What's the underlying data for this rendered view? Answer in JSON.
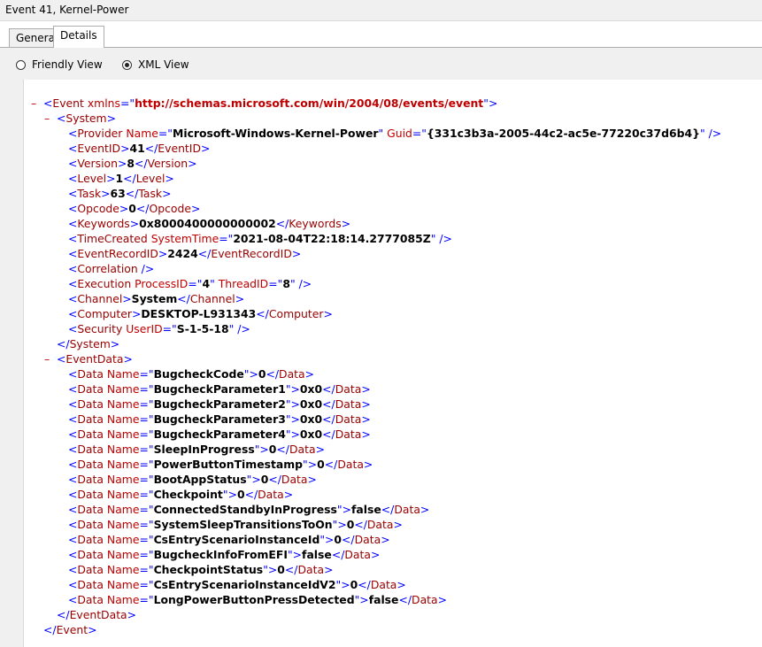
{
  "window": {
    "title": "Event 41, Kernel-Power"
  },
  "tabs": [
    {
      "label": "General"
    },
    {
      "label": "Details"
    }
  ],
  "view": {
    "friendly_label": "Friendly View",
    "xml_label": "XML View",
    "selected": "XML View"
  },
  "colors": {
    "bracket": "#0000ff",
    "tag": "#990000",
    "attr": "#c00000",
    "toggle": "#c00000"
  },
  "xml": {
    "event_open": {
      "tag": "Event",
      "attr": "xmlns",
      "value": "http://schemas.microsoft.com/win/2004/08/events/event"
    },
    "system_tag": "System",
    "system": [
      {
        "tag": "Provider",
        "attrs": [
          {
            "name": "Name",
            "value": "Microsoft-Windows-Kernel-Power"
          },
          {
            "name": "Guid",
            "value": "{331c3b3a-2005-44c2-ac5e-77220c37d6b4}"
          }
        ],
        "self_closing": true
      },
      {
        "tag": "EventID",
        "text": "41"
      },
      {
        "tag": "Version",
        "text": "8"
      },
      {
        "tag": "Level",
        "text": "1"
      },
      {
        "tag": "Task",
        "text": "63"
      },
      {
        "tag": "Opcode",
        "text": "0"
      },
      {
        "tag": "Keywords",
        "text": "0x8000400000000002"
      },
      {
        "tag": "TimeCreated",
        "attrs": [
          {
            "name": "SystemTime",
            "value": "2021-08-04T22:18:14.2777085Z"
          }
        ],
        "self_closing": true
      },
      {
        "tag": "EventRecordID",
        "text": "2424"
      },
      {
        "tag": "Correlation",
        "attrs": [],
        "self_closing": true
      },
      {
        "tag": "Execution",
        "attrs": [
          {
            "name": "ProcessID",
            "value": "4"
          },
          {
            "name": "ThreadID",
            "value": "8"
          }
        ],
        "self_closing": true
      },
      {
        "tag": "Channel",
        "text": "System"
      },
      {
        "tag": "Computer",
        "text": "DESKTOP-L931343"
      },
      {
        "tag": "Security",
        "attrs": [
          {
            "name": "UserID",
            "value": "S-1-5-18"
          }
        ],
        "self_closing": true
      }
    ],
    "eventdata_tag": "EventData",
    "eventdata": [
      {
        "name": "BugcheckCode",
        "value": "0"
      },
      {
        "name": "BugcheckParameter1",
        "value": "0x0"
      },
      {
        "name": "BugcheckParameter2",
        "value": "0x0"
      },
      {
        "name": "BugcheckParameter3",
        "value": "0x0"
      },
      {
        "name": "BugcheckParameter4",
        "value": "0x0"
      },
      {
        "name": "SleepInProgress",
        "value": "0"
      },
      {
        "name": "PowerButtonTimestamp",
        "value": "0"
      },
      {
        "name": "BootAppStatus",
        "value": "0"
      },
      {
        "name": "Checkpoint",
        "value": "0"
      },
      {
        "name": "ConnectedStandbyInProgress",
        "value": "false"
      },
      {
        "name": "SystemSleepTransitionsToOn",
        "value": "0"
      },
      {
        "name": "CsEntryScenarioInstanceId",
        "value": "0"
      },
      {
        "name": "BugcheckInfoFromEFI",
        "value": "false"
      },
      {
        "name": "CheckpointStatus",
        "value": "0"
      },
      {
        "name": "CsEntryScenarioInstanceIdV2",
        "value": "0"
      },
      {
        "name": "LongPowerButtonPressDetected",
        "value": "false"
      }
    ],
    "data_tag": "Data",
    "data_attr": "Name",
    "toggle_glyph": "–"
  }
}
